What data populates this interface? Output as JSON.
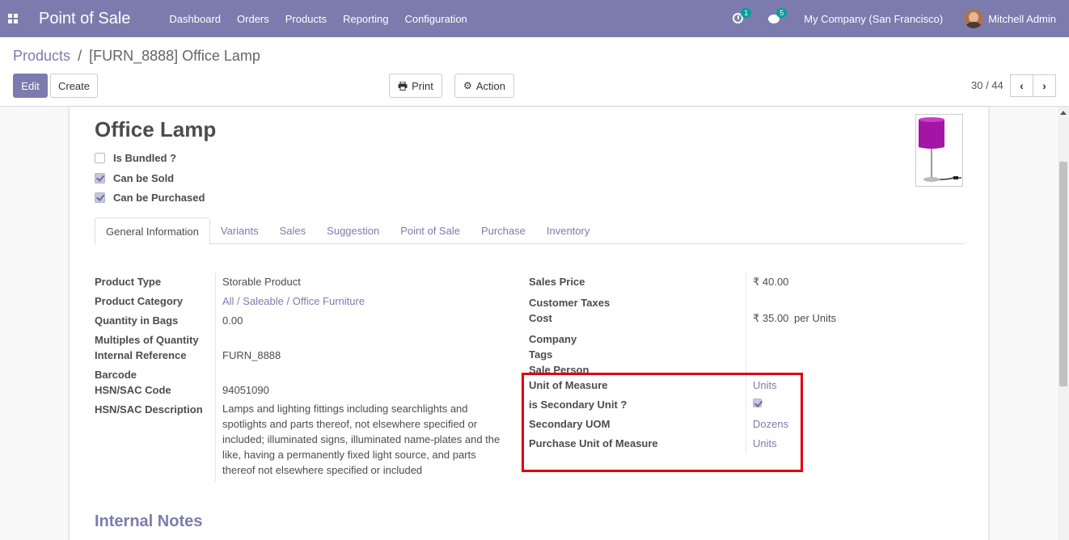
{
  "navbar": {
    "app_name": "Point of Sale",
    "menu": [
      "Dashboard",
      "Orders",
      "Products",
      "Reporting",
      "Configuration"
    ],
    "activity_count": "1",
    "message_count": "5",
    "company": "My Company (San Francisco)",
    "user": "Mitchell Admin"
  },
  "breadcrumb": {
    "parent": "Products",
    "separator": "/",
    "current": "[FURN_8888] Office Lamp"
  },
  "toolbar": {
    "edit": "Edit",
    "create": "Create",
    "print": "Print",
    "action": "Action"
  },
  "pager": {
    "value": "30 / 44"
  },
  "product": {
    "name": "Office Lamp",
    "image_icon": "lamp-image",
    "checkboxes": [
      {
        "label": "Is Bundled ?",
        "checked": false
      },
      {
        "label": "Can be Sold",
        "checked": true
      },
      {
        "label": "Can be Purchased",
        "checked": true
      }
    ]
  },
  "tabs": [
    "General Information",
    "Variants",
    "Sales",
    "Suggestion",
    "Point of Sale",
    "Purchase",
    "Inventory"
  ],
  "left_fields": {
    "product_type": {
      "label": "Product Type",
      "value": "Storable Product"
    },
    "product_category": {
      "label": "Product Category",
      "value": "All / Saleable / Office Furniture"
    },
    "quantity_in_bags": {
      "label": "Quantity in Bags",
      "value": "0.00"
    },
    "multiples_of_quantity": {
      "label": "Multiples of Quantity",
      "value": ""
    },
    "internal_reference": {
      "label": "Internal Reference",
      "value": "FURN_8888"
    },
    "barcode": {
      "label": "Barcode",
      "value": ""
    },
    "hsn_code": {
      "label": "HSN/SAC Code",
      "value": "94051090"
    },
    "hsn_description": {
      "label": "HSN/SAC Description",
      "value": "Lamps and lighting fittings including searchlights and spotlights and parts thereof, not elsewhere specified or included; illuminated signs, illuminated name-plates and the like, having a permanently fixed light source, and parts thereof not elsewhere specified or included"
    }
  },
  "right_fields": {
    "sales_price": {
      "label": "Sales Price",
      "value": "₹ 40.00"
    },
    "customer_taxes": {
      "label": "Customer Taxes",
      "value": ""
    },
    "cost": {
      "label": "Cost",
      "value": "₹ 35.00",
      "unit": "per Units"
    },
    "company": {
      "label": "Company",
      "value": ""
    },
    "tags": {
      "label": "Tags",
      "value": ""
    },
    "sale_person": {
      "label": "Sale Person",
      "value": ""
    },
    "unit_of_measure": {
      "label": "Unit of Measure",
      "value": "Units"
    },
    "is_secondary_unit": {
      "label": "is Secondary Unit ?",
      "checked": true
    },
    "secondary_uom": {
      "label": "Secondary UOM",
      "value": "Dozens"
    },
    "purchase_uom": {
      "label": "Purchase Unit of Measure",
      "value": "Units"
    }
  },
  "internal_notes": {
    "title": "Internal Notes"
  },
  "colors": {
    "brand": "#7c7bad",
    "highlight": "#e0000f"
  }
}
